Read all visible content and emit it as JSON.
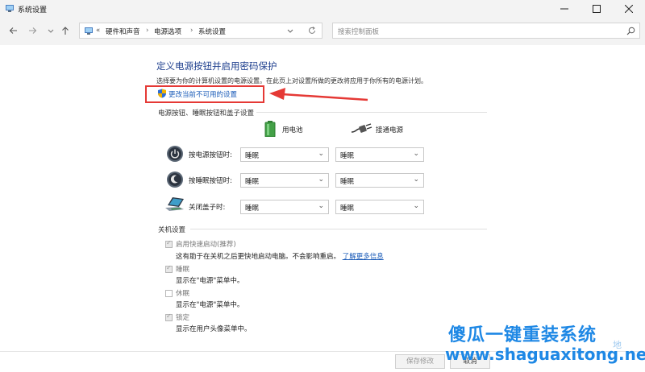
{
  "window": {
    "title": "系统设置",
    "controls": [
      "minimize",
      "maximize",
      "close"
    ]
  },
  "nav": {
    "back_icon": "arrow-left-icon",
    "forward_icon": "arrow-right-icon",
    "history_icon": "chevron-down-icon",
    "up_icon": "arrow-up-icon",
    "breadcrumb_overflow": "«",
    "breadcrumb": [
      "硬件和声音",
      "电源选项",
      "系统设置"
    ],
    "separator": "›",
    "search_placeholder": "搜索控制面板"
  },
  "page": {
    "heading": "定义电源按钮并启用密码保护",
    "subtext": "选择要为你的计算机设置的电源设置。在此页上对设置所做的更改将应用于你所有的电源计划。",
    "change_link": "更改当前不可用的设置"
  },
  "power_buttons": {
    "section_title": "电源按钮、睡眠按钮和盖子设置",
    "col_battery": "用电池",
    "col_plugged": "接通电源",
    "rows": [
      {
        "label": "按电源按钮时:",
        "battery": "睡眠",
        "plugged": "睡眠",
        "icon": "power-button-icon"
      },
      {
        "label": "按睡眠按钮时:",
        "battery": "睡眠",
        "plugged": "睡眠",
        "icon": "sleep-button-icon"
      },
      {
        "label": "关闭盖子时:",
        "battery": "睡眠",
        "plugged": "睡眠",
        "icon": "laptop-lid-icon"
      }
    ]
  },
  "shutdown": {
    "section_title": "关机设置",
    "options": [
      {
        "label": "启用快速启动(推荐)",
        "desc": "这有助于在关机之后更快地启动电脑。不会影响重启。",
        "link": "了解更多信息",
        "checked": true
      },
      {
        "label": "睡眠",
        "desc": "显示在\"电源\"菜单中。",
        "checked": true
      },
      {
        "label": "休眠",
        "desc": "显示在\"电源\"菜单中。",
        "checked": false
      },
      {
        "label": "锁定",
        "desc": "显示在用户头像菜单中。",
        "checked": true
      }
    ]
  },
  "footer": {
    "save_label": "保存修改",
    "cancel_label": "取消"
  },
  "watermark": {
    "line1": "傻瓜一键重装系统",
    "line2": "www.shaguaxitong.net",
    "badge": "地"
  },
  "colors": {
    "heading": "#1e3f8e",
    "link": "#1a5bb8",
    "highlight": "#e53935",
    "watermark": "#1e88e5"
  }
}
